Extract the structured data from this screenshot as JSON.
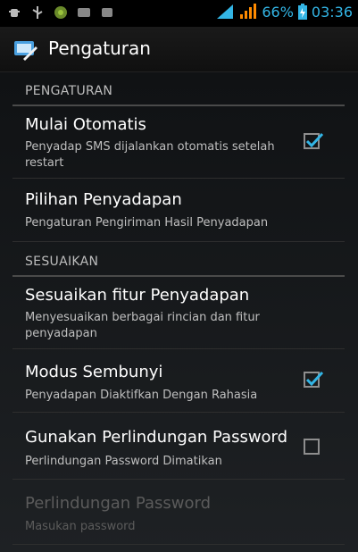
{
  "status_bar": {
    "battery_percent_text": "66%",
    "time": "03:36",
    "accent_color": "#33b5e5",
    "left_icons": [
      "usb-debug-icon",
      "usb-icon",
      "android-icon",
      "bbm-icon",
      "notification-icon"
    ],
    "right_icons": [
      "wifi-signal-icon",
      "cell-signal-icon",
      "battery-charging-icon"
    ]
  },
  "action_bar": {
    "title": "Pengaturan",
    "icon": "settings-app-icon"
  },
  "categories": [
    {
      "label": "PENGATURAN"
    },
    {
      "label": "SESUAIKAN"
    }
  ],
  "prefs": [
    {
      "title": "Mulai Otomatis",
      "summary": "Penyadap SMS dijalankan otomatis setelah restart",
      "checkbox": true,
      "checked": true
    },
    {
      "title": "Pilihan Penyadapan",
      "summary": "Pengaturan Pengiriman Hasil Penyadapan"
    },
    {
      "title": "Sesuaikan fitur Penyadapan",
      "summary": "Menyesuaikan berbagai rincian dan fitur penyadapan"
    },
    {
      "title": "Modus Sembunyi",
      "summary": "Penyadapan Diaktifkan Dengan Rahasia",
      "checkbox": true,
      "checked": true
    },
    {
      "title": "Gunakan Perlindungan Password",
      "summary": "Perlindungan Password Dimatikan",
      "checkbox": true,
      "checked": false
    },
    {
      "title": "Perlindungan Password",
      "summary": "Masukan password",
      "enabled": false
    }
  ]
}
